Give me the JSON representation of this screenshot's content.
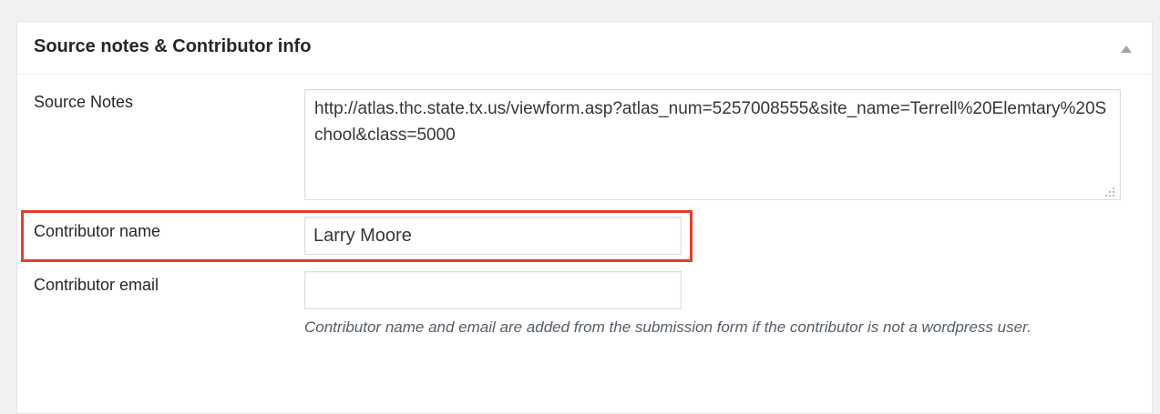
{
  "metabox": {
    "title": "Source notes & Contributor info",
    "toggle_icon": "triangle-up-icon"
  },
  "fields": {
    "source_notes": {
      "label": "Source Notes",
      "value": "http://atlas.thc.state.tx.us/viewform.asp?atlas_num=5257008555&site_name=Terrell%20Elemtary%20School&class=5000"
    },
    "contributor_name": {
      "label": "Contributor name",
      "value": "Larry Moore"
    },
    "contributor_email": {
      "label": "Contributor email",
      "value": "",
      "description": "Contributor name and email are added from the submission form if the contributor is not a wordpress user."
    }
  },
  "colors": {
    "highlight_border": "#e0402a",
    "background": "#f1f1f1",
    "panel": "#ffffff"
  }
}
